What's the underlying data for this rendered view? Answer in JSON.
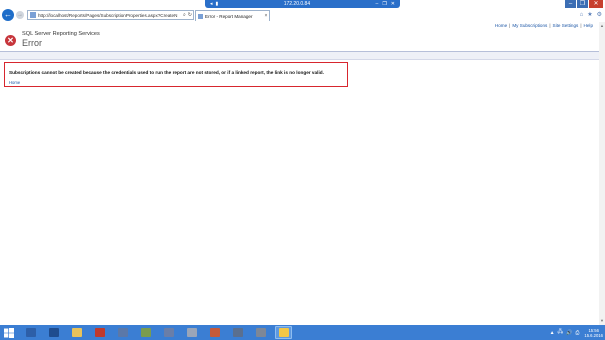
{
  "remote_session": {
    "host": "172.20.0.84",
    "icons": [
      "pin-icon",
      "signal-icon"
    ],
    "controls": [
      "minimize",
      "restore",
      "close"
    ]
  },
  "browser": {
    "url": "http://localhost/Reports/Pages/SubscriptionProperties.aspx?CreateN",
    "tab_title": "Error - Report Manager",
    "back_icon": "←",
    "forward_icon": "→",
    "tab_close": "×",
    "search_icon": "⌕",
    "refresh_icon": "↻",
    "toolbar": [
      "home-icon",
      "favorites-icon",
      "tools-icon"
    ]
  },
  "top_links": [
    {
      "label": "Home"
    },
    {
      "label": "My Subscriptions"
    },
    {
      "label": "Site Settings"
    },
    {
      "label": "Help"
    }
  ],
  "header": {
    "product_name": "SQL Server Reporting Services",
    "page_title": "Error"
  },
  "error": {
    "message": "Subscriptions cannot be created because the credentials used to run the report are not stored, or if a linked report, the link is no longer valid.",
    "home_link": "Home"
  },
  "taskbar": {
    "items": [
      {
        "name": "server-manager-icon",
        "color": "#2d5fa8"
      },
      {
        "name": "powershell-icon",
        "color": "#1e4c8f"
      },
      {
        "name": "file-explorer-icon",
        "color": "#e8c25a"
      },
      {
        "name": "toolbox-icon",
        "color": "#c0392b"
      },
      {
        "name": "computer-management-icon",
        "color": "#5b78a8"
      },
      {
        "name": "network-icon",
        "color": "#7a9c4f"
      },
      {
        "name": "document-icon",
        "color": "#6a7ea8"
      },
      {
        "name": "report-icon",
        "color": "#9aa5b8"
      },
      {
        "name": "clock-tool-icon",
        "color": "#c65a3a"
      },
      {
        "name": "server-icon",
        "color": "#5a6f8f"
      },
      {
        "name": "printer-icon",
        "color": "#7d8797"
      },
      {
        "name": "internet-explorer-icon",
        "color": "#f3c746",
        "active": true
      }
    ],
    "tray_icons": [
      "▲",
      "🖧",
      "🔊",
      "⎙"
    ],
    "time": "15:56",
    "date": "15.6.2016"
  }
}
